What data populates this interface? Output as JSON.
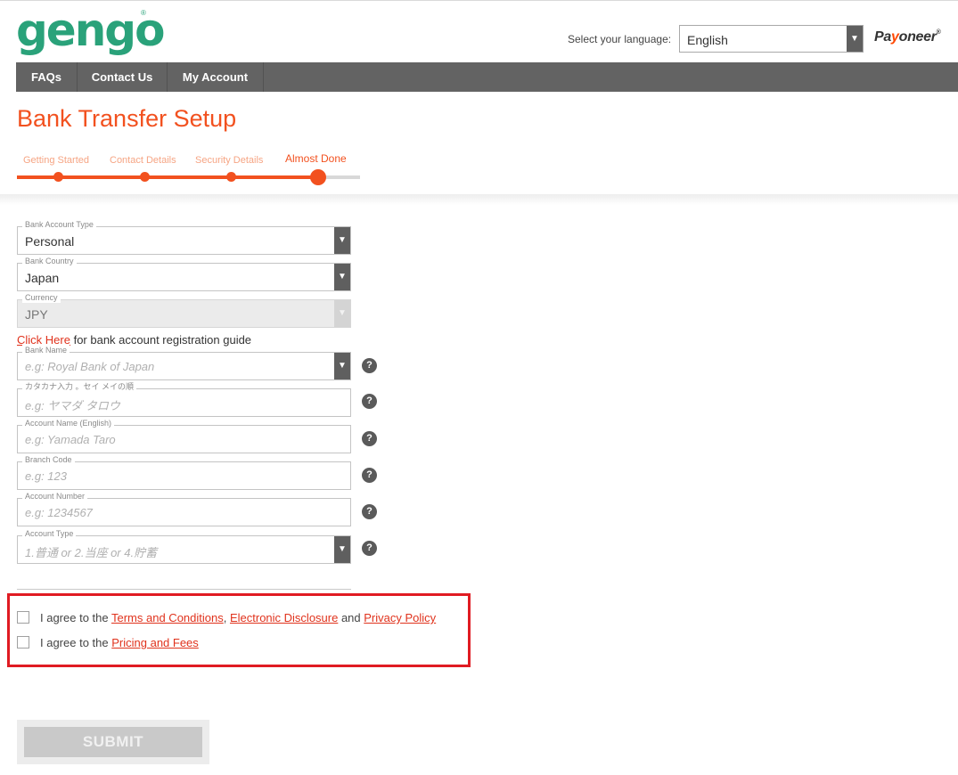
{
  "header": {
    "logo_text": "gengo",
    "logo_mark": "®",
    "language_label": "Select your language:",
    "language_value": "English",
    "partner_logo": {
      "pre": "Pa",
      "accent": "y",
      "post": "oneer",
      "mark": "®"
    }
  },
  "nav": {
    "items": [
      {
        "label": "FAQs"
      },
      {
        "label": "Contact Us"
      },
      {
        "label": "My Account"
      }
    ]
  },
  "page": {
    "title": "Bank Transfer Setup"
  },
  "stepper": {
    "steps": [
      {
        "label": "Getting Started"
      },
      {
        "label": "Contact Details"
      },
      {
        "label": "Security Details"
      },
      {
        "label": "Almost Done"
      }
    ],
    "current_step": 4
  },
  "form": {
    "bank_account_type": {
      "label": "Bank Account Type",
      "value": "Personal"
    },
    "bank_country": {
      "label": "Bank Country",
      "value": "Japan"
    },
    "currency": {
      "label": "Currency",
      "value": "JPY"
    },
    "guide_link": "Click Here",
    "guide_text": " for bank account registration guide",
    "bank_name": {
      "label": "Bank Name",
      "placeholder": "e.g: Royal Bank of Japan"
    },
    "kana_name": {
      "label": "カタカナ入力 。セイ メイの順",
      "placeholder": "e.g: ヤマダ タロウ"
    },
    "account_name_en": {
      "label": "Account Name (English)",
      "placeholder": "e.g: Yamada Taro"
    },
    "branch_code": {
      "label": "Branch Code",
      "placeholder": "e.g: 123"
    },
    "account_number": {
      "label": "Account Number",
      "placeholder": "e.g: 1234567"
    },
    "account_type": {
      "label": "Account Type",
      "placeholder": "1.普通 or 2.当座 or 4.貯蓄"
    },
    "help_glyph": "?"
  },
  "agreements": {
    "prefix": "I agree to the ",
    "terms": "Terms and Conditions",
    "comma": ", ",
    "disclosure": "Electronic Disclosure",
    "and": " and ",
    "privacy": "Privacy Policy",
    "pricing": "Pricing and Fees"
  },
  "submit_label": "SUBMIT",
  "icons": {
    "dropdown": "chevron-down-icon",
    "help": "help-icon"
  },
  "colors": {
    "brand_green": "#2aa27a",
    "accent_orange": "#f2511f",
    "link_red": "#e0321c",
    "highlight_red": "#e01b22",
    "nav_gray": "#636363"
  }
}
